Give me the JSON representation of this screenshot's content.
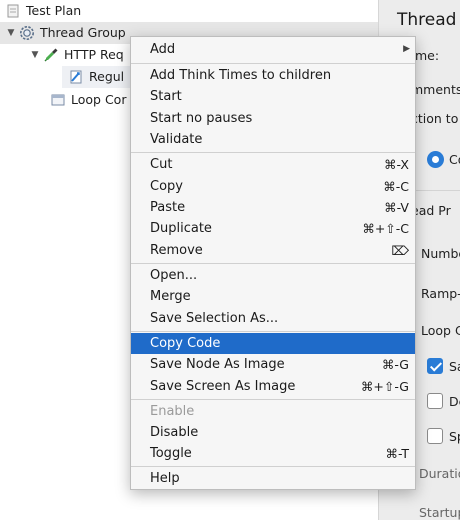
{
  "tree": {
    "nodes": [
      {
        "label": "Test Plan",
        "expanded": "",
        "icon": "test-plan-icon"
      },
      {
        "label": "Thread Group",
        "expanded": "▼",
        "icon": "gear-icon"
      },
      {
        "label": "HTTP Req",
        "expanded": "▼",
        "icon": "pipette-icon"
      },
      {
        "label": "Regul",
        "expanded": "",
        "icon": "regex-extractor-icon"
      },
      {
        "label": "Loop Cor",
        "expanded": "",
        "icon": "loop-controller-icon"
      }
    ]
  },
  "right_panel": {
    "title": "Thread G",
    "name_label": "me:",
    "comments_label": "mments",
    "action_label": "ction to",
    "continue_label": "Co",
    "thread_props_label": "ead Pr",
    "number_label": "Numbe",
    "rampup_label": "Ramp-",
    "loop_label": "Loop C",
    "same_user_label": "Sa",
    "delay_label": "De",
    "specify_label": "Sp",
    "duration_label": "Duratio",
    "startup_label": "Startup"
  },
  "menu": {
    "items": [
      {
        "label": "Add",
        "shortcut": "",
        "submenu": true
      },
      {
        "label": "Add Think Times to children",
        "shortcut": ""
      },
      {
        "label": "Start",
        "shortcut": ""
      },
      {
        "label": "Start no pauses",
        "shortcut": ""
      },
      {
        "label": "Validate",
        "shortcut": ""
      },
      {
        "label": "Cut",
        "shortcut": "⌘-X"
      },
      {
        "label": "Copy",
        "shortcut": "⌘-C"
      },
      {
        "label": "Paste",
        "shortcut": "⌘-V"
      },
      {
        "label": "Duplicate",
        "shortcut": "⌘+⇧-C"
      },
      {
        "label": "Remove",
        "shortcut": "⌦"
      },
      {
        "label": "Open...",
        "shortcut": ""
      },
      {
        "label": "Merge",
        "shortcut": ""
      },
      {
        "label": "Save Selection As...",
        "shortcut": ""
      },
      {
        "label": "Copy Code",
        "shortcut": ""
      },
      {
        "label": "Save Node As Image",
        "shortcut": "⌘-G"
      },
      {
        "label": "Save Screen As Image",
        "shortcut": "⌘+⇧-G"
      },
      {
        "label": "Enable",
        "shortcut": ""
      },
      {
        "label": "Disable",
        "shortcut": ""
      },
      {
        "label": "Toggle",
        "shortcut": "⌘-T"
      },
      {
        "label": "Help",
        "shortcut": ""
      }
    ],
    "highlighted": "Copy Code",
    "disabled": "Enable"
  },
  "colors": {
    "highlight": "#1f6bc9",
    "accent": "#2a7cd6",
    "menu_bg": "#f6f6f6"
  }
}
